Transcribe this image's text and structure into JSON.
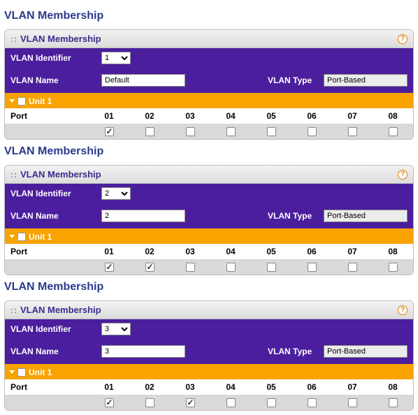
{
  "labels": {
    "page_heading": "VLAN Membership",
    "panel_title": "VLAN Membership",
    "vlan_id": "VLAN Identifier",
    "vlan_name": "VLAN Name",
    "vlan_type": "VLAN Type",
    "unit": "Unit 1",
    "port": "Port",
    "help": "?"
  },
  "ports": [
    "01",
    "02",
    "03",
    "04",
    "05",
    "06",
    "07",
    "08"
  ],
  "sections": [
    {
      "vlan_id": "1",
      "vlan_name": "Default",
      "vlan_type": "Port-Based",
      "checked": [
        true,
        false,
        false,
        false,
        false,
        false,
        false,
        false
      ]
    },
    {
      "vlan_id": "2",
      "vlan_name": "2",
      "vlan_type": "Port-Based",
      "checked": [
        true,
        true,
        false,
        false,
        false,
        false,
        false,
        false
      ]
    },
    {
      "vlan_id": "3",
      "vlan_name": "3",
      "vlan_type": "Port-Based",
      "checked": [
        true,
        false,
        true,
        false,
        false,
        false,
        false,
        false
      ]
    }
  ]
}
